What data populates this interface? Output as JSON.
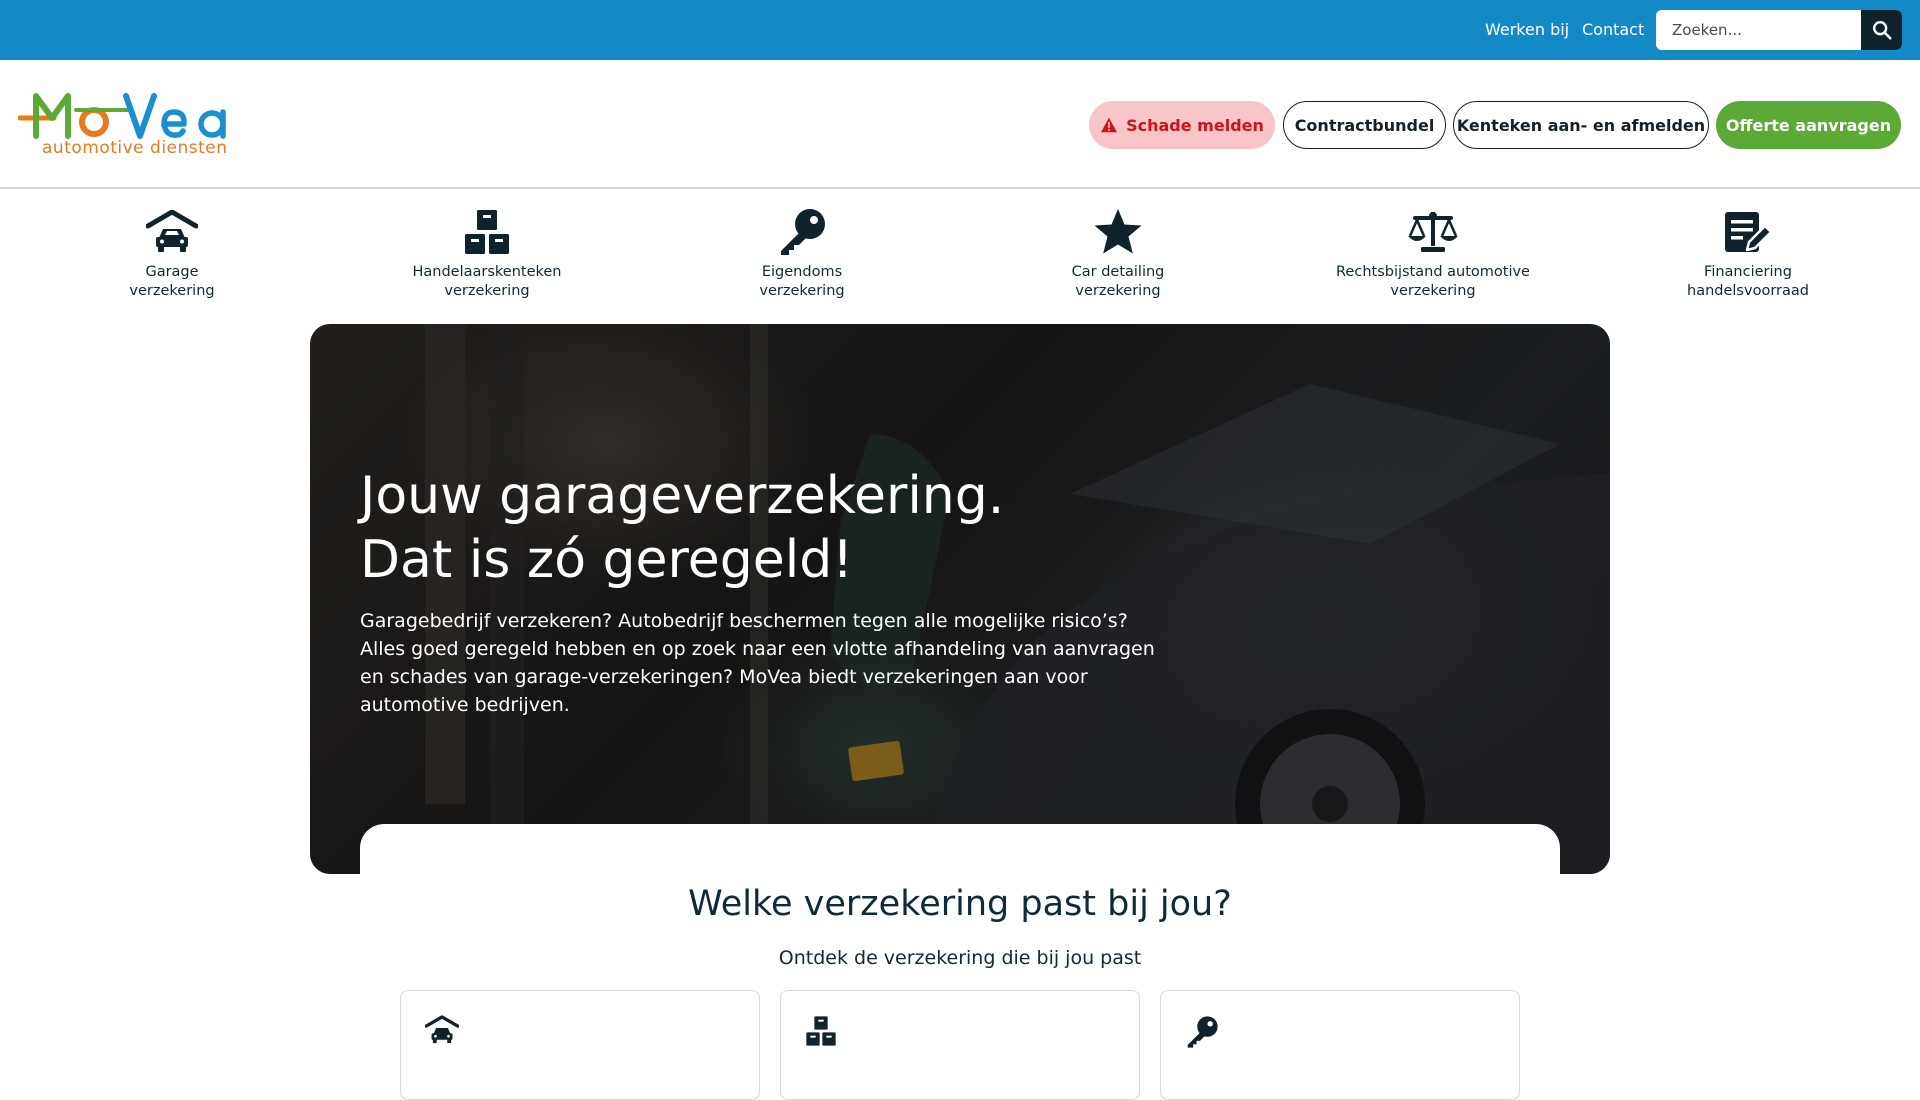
{
  "topbar": {
    "links": [
      {
        "label": "Werken bij"
      },
      {
        "label": "Contact"
      }
    ],
    "search": {
      "placeholder": "Zoeken...",
      "icon": "search-icon"
    },
    "background": "#1389c5"
  },
  "header": {
    "logo": {
      "text": "MoVea",
      "subtitle": "automotive diensten"
    },
    "buttons": {
      "damage": {
        "label": "Schade melden",
        "icon": "warning-icon",
        "color": "#d0121b",
        "bg": "#f7c5c8"
      },
      "contract": {
        "label": "Contractbundel"
      },
      "plate": {
        "label": "Kenteken aan- en afmelden"
      },
      "offer": {
        "label": "Offerte aanvragen",
        "bg": "#5aaa35"
      }
    }
  },
  "categories": [
    {
      "icon": "garage-car-icon",
      "line1": "Garage",
      "line2": "verzekering"
    },
    {
      "icon": "boxes-icon",
      "line1": "Handelaarskenteken",
      "line2": "verzekering"
    },
    {
      "icon": "key-icon",
      "line1": "Eigendoms",
      "line2": "verzekering"
    },
    {
      "icon": "star-icon",
      "line1": "Car detailing",
      "line2": "verzekering"
    },
    {
      "icon": "scale-icon",
      "line1": "Rechtsbijstand automotive",
      "line2": "verzekering"
    },
    {
      "icon": "document-edit-icon",
      "line1": "Financiering",
      "line2": "handelsvoorraad"
    }
  ],
  "hero": {
    "title_line1": "Jouw garageverzekering.",
    "title_line2": "Dat is zó geregeld!",
    "text": "Garagebedrijf verzekeren? Autobedrijf beschermen tegen alle mogelijke risico’s? Alles goed geregeld hebben en op zoek naar een vlotte afhandeling van aanvragen en schades van garage-verzekeringen? MoVea biedt verzekeringen aan voor automotive bedrijven."
  },
  "section": {
    "title": "Welke verzekering past bij jou?",
    "subtitle": "Ontdek de verzekering die bij jou past",
    "cards": [
      {
        "icon": "garage-car-icon"
      },
      {
        "icon": "boxes-icon"
      },
      {
        "icon": "key-icon"
      }
    ]
  },
  "colors": {
    "dark": "#10232d",
    "orange": "#e87a1e",
    "blue": "#1a8fd0",
    "green": "#5aaa35"
  }
}
